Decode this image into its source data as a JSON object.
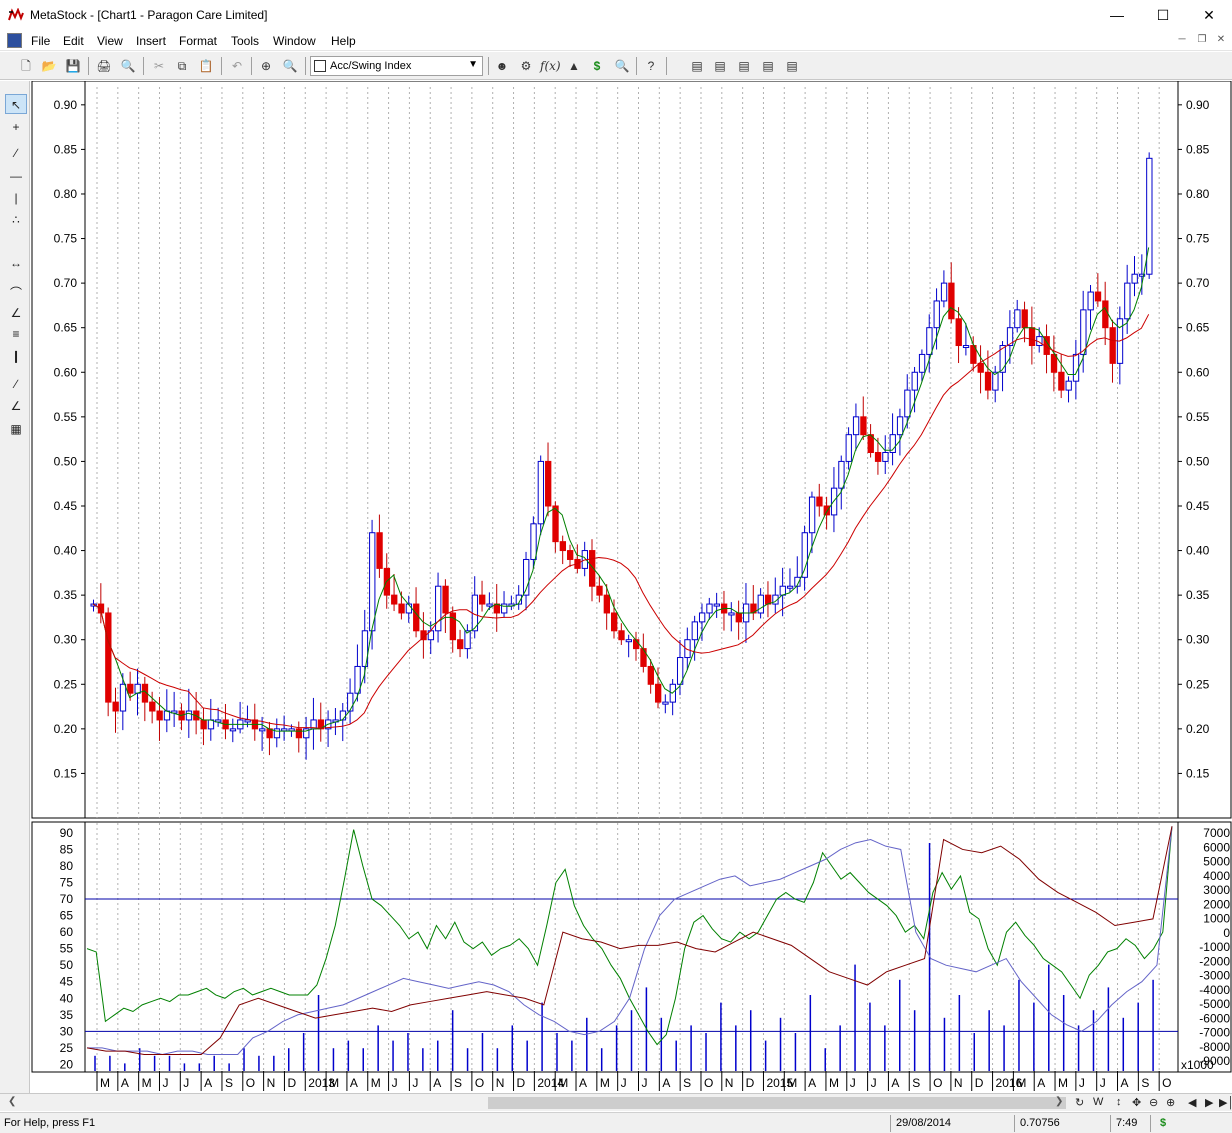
{
  "window": {
    "title": "MetaStock - [Chart1 - Paragon Care Limited]"
  },
  "menu": [
    "File",
    "Edit",
    "View",
    "Insert",
    "Format",
    "Tools",
    "Window",
    "Help"
  ],
  "toolbar": {
    "indicator_select": "Acc/Swing Index"
  },
  "price_axis": {
    "ticks": [
      "0.90",
      "0.85",
      "0.80",
      "0.75",
      "0.70",
      "0.65",
      "0.60",
      "0.55",
      "0.50",
      "0.45",
      "0.40",
      "0.35",
      "0.30",
      "0.25",
      "0.20",
      "0.15"
    ]
  },
  "indicator_axis_left": {
    "ticks": [
      "90",
      "85",
      "80",
      "75",
      "70",
      "65",
      "60",
      "55",
      "50",
      "45",
      "40",
      "35",
      "30",
      "25",
      "20"
    ]
  },
  "indicator_axis_right": {
    "ticks": [
      "7000",
      "6000",
      "5000",
      "4000",
      "3000",
      "2000",
      "1000",
      "0",
      "-1000",
      "-2000",
      "-3000",
      "-4000",
      "-5000",
      "-6000",
      "-7000",
      "-8000",
      "-9000"
    ],
    "multiplier": "x1000"
  },
  "time_axis": [
    "M",
    "A",
    "M",
    "J",
    "J",
    "A",
    "S",
    "O",
    "N",
    "D",
    "2013",
    "M",
    "A",
    "M",
    "J",
    "J",
    "A",
    "S",
    "O",
    "N",
    "D",
    "2014",
    "M",
    "A",
    "M",
    "J",
    "J",
    "A",
    "S",
    "O",
    "N",
    "D",
    "2015",
    "M",
    "A",
    "M",
    "J",
    "J",
    "A",
    "S",
    "O",
    "N",
    "D",
    "2016",
    "M",
    "A",
    "M",
    "J",
    "J",
    "A",
    "S",
    "O"
  ],
  "status": {
    "help": "For Help, press F1",
    "date": "29/08/2014",
    "value": "0.70756",
    "time": "7:49",
    "dollar": "$"
  },
  "chart_data": {
    "type": "candlestick",
    "title": "",
    "price_range": [
      0.1,
      0.92
    ],
    "indicator_range": [
      18,
      93
    ],
    "moving_averages": [
      "short (green)",
      "long (red)"
    ],
    "overbought_line": 70,
    "oversold_line": 30,
    "price_closes": [
      0.34,
      0.33,
      0.23,
      0.22,
      0.25,
      0.24,
      0.25,
      0.23,
      0.22,
      0.21,
      0.22,
      0.22,
      0.21,
      0.22,
      0.21,
      0.2,
      0.21,
      0.21,
      0.2,
      0.2,
      0.21,
      0.21,
      0.2,
      0.2,
      0.19,
      0.2,
      0.2,
      0.2,
      0.19,
      0.2,
      0.21,
      0.2,
      0.21,
      0.21,
      0.22,
      0.24,
      0.27,
      0.31,
      0.42,
      0.38,
      0.35,
      0.34,
      0.33,
      0.34,
      0.31,
      0.3,
      0.31,
      0.36,
      0.33,
      0.3,
      0.29,
      0.31,
      0.35,
      0.34,
      0.34,
      0.33,
      0.34,
      0.34,
      0.35,
      0.39,
      0.43,
      0.5,
      0.45,
      0.41,
      0.4,
      0.39,
      0.38,
      0.4,
      0.36,
      0.35,
      0.33,
      0.31,
      0.3,
      0.3,
      0.29,
      0.27,
      0.25,
      0.23,
      0.23,
      0.25,
      0.28,
      0.3,
      0.32,
      0.33,
      0.34,
      0.34,
      0.33,
      0.33,
      0.32,
      0.34,
      0.33,
      0.35,
      0.34,
      0.35,
      0.36,
      0.36,
      0.37,
      0.42,
      0.46,
      0.45,
      0.44,
      0.47,
      0.5,
      0.53,
      0.55,
      0.53,
      0.51,
      0.5,
      0.51,
      0.53,
      0.55,
      0.58,
      0.6,
      0.62,
      0.65,
      0.68,
      0.7,
      0.66,
      0.63,
      0.63,
      0.61,
      0.6,
      0.58,
      0.6,
      0.63,
      0.65,
      0.67,
      0.65,
      0.63,
      0.64,
      0.62,
      0.6,
      0.58,
      0.59,
      0.62,
      0.67,
      0.69,
      0.68,
      0.65,
      0.61,
      0.66,
      0.7,
      0.71,
      0.71,
      0.84
    ],
    "osc1_green": [
      55,
      54,
      33,
      35,
      37,
      36,
      38,
      39,
      40,
      39,
      41,
      41,
      42,
      43,
      41,
      40,
      42,
      43,
      41,
      42,
      43,
      42,
      41,
      41,
      41,
      44,
      52,
      62,
      76,
      91,
      80,
      70,
      68,
      65,
      62,
      58,
      60,
      55,
      62,
      58,
      63,
      57,
      55,
      57,
      53,
      55,
      56,
      58,
      55,
      50,
      62,
      75,
      79,
      68,
      62,
      58,
      55,
      50,
      46,
      40,
      35,
      30,
      26,
      29,
      40,
      55,
      63,
      65,
      61,
      58,
      57,
      60,
      58,
      60,
      65,
      70,
      72,
      70,
      69,
      75,
      84,
      80,
      76,
      78,
      75,
      72,
      70,
      68,
      65,
      60,
      62,
      58,
      72,
      78,
      73,
      77,
      66,
      64,
      55,
      50,
      60,
      63,
      59,
      56,
      52,
      50,
      48,
      44,
      40,
      47,
      50,
      54,
      55,
      58,
      56,
      52,
      55,
      60,
      92
    ],
    "osc2_blue": [
      25,
      25,
      24,
      24,
      24,
      23,
      24,
      24,
      23,
      23,
      23,
      28,
      30,
      33,
      35,
      36,
      37,
      38,
      40,
      42,
      44,
      46,
      45,
      44,
      43,
      44,
      45,
      44,
      42,
      38,
      35,
      33,
      30,
      29,
      30,
      33,
      40,
      55,
      65,
      70,
      72,
      74,
      76,
      77,
      74,
      75,
      76,
      78,
      80,
      82,
      85,
      87,
      88,
      86,
      85,
      60,
      52,
      50,
      49,
      48,
      50,
      52,
      45,
      40,
      35,
      32,
      30,
      33,
      38,
      42,
      45,
      50,
      92
    ],
    "osc3_red": [
      25,
      24,
      24,
      23,
      23,
      23,
      23,
      28,
      38,
      40,
      38,
      36,
      34,
      35,
      36,
      37,
      36,
      38,
      39,
      40,
      41,
      42,
      41,
      40,
      38,
      60,
      58,
      57,
      55,
      56,
      56,
      57,
      55,
      54,
      57,
      60,
      58,
      56,
      52,
      48,
      46,
      44,
      48,
      50,
      52,
      88,
      85,
      84,
      86,
      82,
      76,
      72,
      69,
      66,
      62,
      63,
      64,
      92
    ],
    "volume_relative": [
      2,
      2,
      1,
      3,
      2,
      2,
      1,
      1,
      2,
      1,
      3,
      2,
      2,
      3,
      5,
      10,
      3,
      4,
      3,
      6,
      4,
      5,
      3,
      4,
      8,
      3,
      5,
      3,
      6,
      4,
      9,
      5,
      4,
      7,
      3,
      6,
      8,
      11,
      7,
      4,
      6,
      5,
      9,
      6,
      8,
      4,
      7,
      5,
      10,
      3,
      6,
      14,
      9,
      6,
      12,
      8,
      30,
      7,
      10,
      5,
      8,
      6,
      12,
      9,
      14,
      10,
      6,
      8,
      11,
      7,
      9,
      12
    ]
  }
}
